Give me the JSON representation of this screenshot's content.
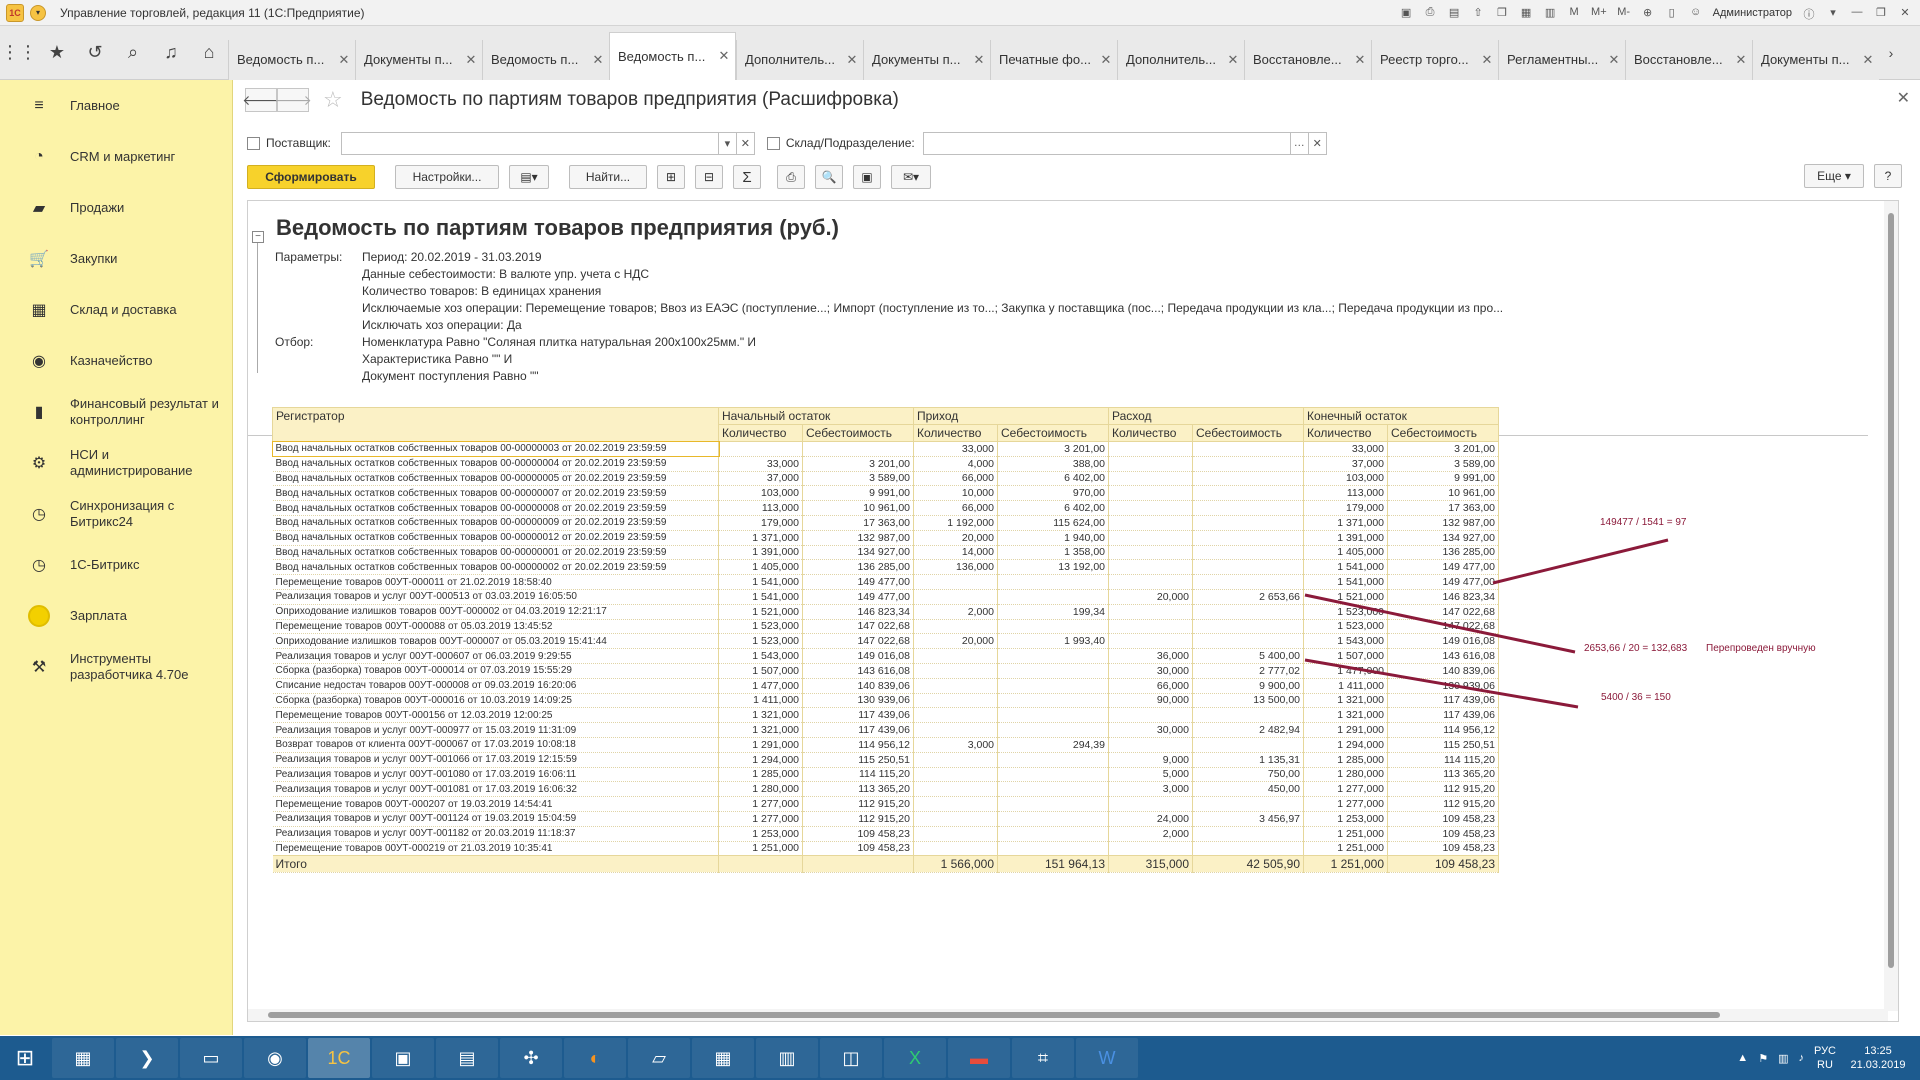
{
  "window": {
    "title": "Управление торговлей, редакция 11  (1С:Предприятие)",
    "user": "Администратор",
    "logo_text": "1С",
    "tools": [
      "M",
      "M+",
      "M-"
    ]
  },
  "tabs": [
    {
      "label": "Ведомость п..."
    },
    {
      "label": "Документы п..."
    },
    {
      "label": "Ведомость п..."
    },
    {
      "label": "Ведомость п...",
      "active": true
    },
    {
      "label": "Дополнитель..."
    },
    {
      "label": "Документы п..."
    },
    {
      "label": "Печатные фо..."
    },
    {
      "label": "Дополнитель..."
    },
    {
      "label": "Восстановле..."
    },
    {
      "label": "Реестр торго..."
    },
    {
      "label": "Регламентны..."
    },
    {
      "label": "Восстановле..."
    },
    {
      "label": "Документы п..."
    }
  ],
  "sidebar": {
    "items": [
      {
        "label": "Главное",
        "icon": "menu-icon"
      },
      {
        "label": "CRM и маркетинг",
        "icon": "crm-icon"
      },
      {
        "label": "Продажи",
        "icon": "sales-bag-icon"
      },
      {
        "label": "Закупки",
        "icon": "cart-icon"
      },
      {
        "label": "Склад и доставка",
        "icon": "warehouse-icon"
      },
      {
        "label": "Казначейство",
        "icon": "treasury-icon"
      },
      {
        "label": "Финансовый результат и контроллинг",
        "icon": "chart-icon"
      },
      {
        "label": "НСИ и администрирование",
        "icon": "gear-icon"
      },
      {
        "label": "Синхронизация с Битрикс24",
        "icon": "sync-icon"
      },
      {
        "label": "1С-Битрикс",
        "icon": "bitrix-icon"
      },
      {
        "label": "Зарплата",
        "icon": "salary-coin-icon"
      },
      {
        "label": "Инструменты разработчика 4.70e",
        "icon": "dev-tools-icon"
      }
    ]
  },
  "form": {
    "title": "Ведомость по партиям товаров предприятия (Расшифровка)",
    "filter_supplier_label": "Поставщик:",
    "filter_supplier_value": "",
    "filter_warehouse_label": "Склад/Подразделение:",
    "filter_warehouse_value": "",
    "btn_generate": "Сформировать",
    "btn_settings": "Настройки...",
    "btn_find": "Найти...",
    "btn_more": "Еще",
    "btn_help": "?"
  },
  "report": {
    "title": "Ведомость по партиям товаров предприятия (руб.)",
    "params_label": "Параметры:",
    "filter_label": "Отбор:",
    "params": [
      "Период: 20.02.2019 - 31.03.2019",
      "Данные себестоимости: В валюте упр. учета с НДС",
      "Количество товаров: В единицах хранения",
      "Исключаемые хоз операции: Перемещение товаров; Ввоз из ЕАЭС (поступление...; Импорт (поступление из то...; Закупка у поставщика (пос...; Передача продукции из кла...; Передача продукции из про...",
      "Исключать хоз операции: Да"
    ],
    "filters": [
      "Номенклатура Равно \"Соляная плитка натуральная 200х100х25мм.\" И",
      "Характеристика Равно \"\" И",
      "Документ поступления Равно \"\""
    ],
    "columns": {
      "registrar": "Регистратор",
      "group_start": "Начальный остаток",
      "group_in": "Приход",
      "group_out": "Расход",
      "group_end": "Конечный остаток",
      "qty": "Количество",
      "cost": "Себестоимость"
    },
    "rows": [
      [
        "Ввод начальных остатков собственных товаров 00-00000003 от 20.02.2019 23:59:59",
        "",
        "",
        "33,000",
        "3 201,00",
        "",
        "",
        "33,000",
        "3 201,00"
      ],
      [
        "Ввод начальных остатков собственных товаров 00-00000004 от 20.02.2019 23:59:59",
        "33,000",
        "3 201,00",
        "4,000",
        "388,00",
        "",
        "",
        "37,000",
        "3 589,00"
      ],
      [
        "Ввод начальных остатков собственных товаров 00-00000005 от 20.02.2019 23:59:59",
        "37,000",
        "3 589,00",
        "66,000",
        "6 402,00",
        "",
        "",
        "103,000",
        "9 991,00"
      ],
      [
        "Ввод начальных остатков собственных товаров 00-00000007 от 20.02.2019 23:59:59",
        "103,000",
        "9 991,00",
        "10,000",
        "970,00",
        "",
        "",
        "113,000",
        "10 961,00"
      ],
      [
        "Ввод начальных остатков собственных товаров 00-00000008 от 20.02.2019 23:59:59",
        "113,000",
        "10 961,00",
        "66,000",
        "6 402,00",
        "",
        "",
        "179,000",
        "17 363,00"
      ],
      [
        "Ввод начальных остатков собственных товаров 00-00000009 от 20.02.2019 23:59:59",
        "179,000",
        "17 363,00",
        "1 192,000",
        "115 624,00",
        "",
        "",
        "1 371,000",
        "132 987,00"
      ],
      [
        "Ввод начальных остатков собственных товаров 00-00000012 от 20.02.2019 23:59:59",
        "1 371,000",
        "132 987,00",
        "20,000",
        "1 940,00",
        "",
        "",
        "1 391,000",
        "134 927,00"
      ],
      [
        "Ввод начальных остатков собственных товаров 00-00000001 от 20.02.2019 23:59:59",
        "1 391,000",
        "134 927,00",
        "14,000",
        "1 358,00",
        "",
        "",
        "1 405,000",
        "136 285,00"
      ],
      [
        "Ввод начальных остатков собственных товаров 00-00000002 от 20.02.2019 23:59:59",
        "1 405,000",
        "136 285,00",
        "136,000",
        "13 192,00",
        "",
        "",
        "1 541,000",
        "149 477,00"
      ],
      [
        "Перемещение товаров 00УТ-000011 от 21.02.2019 18:58:40",
        "1 541,000",
        "149 477,00",
        "",
        "",
        "",
        "",
        "1 541,000",
        "149 477,00"
      ],
      [
        "Реализация товаров и услуг 00УТ-000513 от 03.03.2019 16:05:50",
        "1 541,000",
        "149 477,00",
        "",
        "",
        "20,000",
        "2 653,66",
        "1 521,000",
        "146 823,34"
      ],
      [
        "Оприходование излишков товаров 00УТ-000002 от 04.03.2019 12:21:17",
        "1 521,000",
        "146 823,34",
        "2,000",
        "199,34",
        "",
        "",
        "1 523,000",
        "147 022,68"
      ],
      [
        "Перемещение товаров 00УТ-000088 от 05.03.2019 13:45:52",
        "1 523,000",
        "147 022,68",
        "",
        "",
        "",
        "",
        "1 523,000",
        "147 022,68"
      ],
      [
        "Оприходование излишков товаров 00УТ-000007 от 05.03.2019 15:41:44",
        "1 523,000",
        "147 022,68",
        "20,000",
        "1 993,40",
        "",
        "",
        "1 543,000",
        "149 016,08"
      ],
      [
        "Реализация товаров и услуг 00УТ-000607 от 06.03.2019 9:29:55",
        "1 543,000",
        "149 016,08",
        "",
        "",
        "36,000",
        "5 400,00",
        "1 507,000",
        "143 616,08"
      ],
      [
        "Сборка (разборка) товаров 00УТ-000014 от 07.03.2019 15:55:29",
        "1 507,000",
        "143 616,08",
        "",
        "",
        "30,000",
        "2 777,02",
        "1 477,000",
        "140 839,06"
      ],
      [
        "Списание недостач товаров 00УТ-000008 от 09.03.2019 16:20:06",
        "1 477,000",
        "140 839,06",
        "",
        "",
        "66,000",
        "9 900,00",
        "1 411,000",
        "130 939,06"
      ],
      [
        "Сборка (разборка) товаров 00УТ-000016 от 10.03.2019 14:09:25",
        "1 411,000",
        "130 939,06",
        "",
        "",
        "90,000",
        "13 500,00",
        "1 321,000",
        "117 439,06"
      ],
      [
        "Перемещение товаров 00УТ-000156 от 12.03.2019 12:00:25",
        "1 321,000",
        "117 439,06",
        "",
        "",
        "",
        "",
        "1 321,000",
        "117 439,06"
      ],
      [
        "Реализация товаров и услуг 00УТ-000977 от 15.03.2019 11:31:09",
        "1 321,000",
        "117 439,06",
        "",
        "",
        "30,000",
        "2 482,94",
        "1 291,000",
        "114 956,12"
      ],
      [
        "Возврат товаров от клиента 00УТ-000067 от 17.03.2019 10:08:18",
        "1 291,000",
        "114 956,12",
        "3,000",
        "294,39",
        "",
        "",
        "1 294,000",
        "115 250,51"
      ],
      [
        "Реализация товаров и услуг 00УТ-001066 от 17.03.2019 12:15:59",
        "1 294,000",
        "115 250,51",
        "",
        "",
        "9,000",
        "1 135,31",
        "1 285,000",
        "114 115,20"
      ],
      [
        "Реализация товаров и услуг 00УТ-001080 от 17.03.2019 16:06:11",
        "1 285,000",
        "114 115,20",
        "",
        "",
        "5,000",
        "750,00",
        "1 280,000",
        "113 365,20"
      ],
      [
        "Реализация товаров и услуг 00УТ-001081 от 17.03.2019 16:06:32",
        "1 280,000",
        "113 365,20",
        "",
        "",
        "3,000",
        "450,00",
        "1 277,000",
        "112 915,20"
      ],
      [
        "Перемещение товаров 00УТ-000207 от 19.03.2019 14:54:41",
        "1 277,000",
        "112 915,20",
        "",
        "",
        "",
        "",
        "1 277,000",
        "112 915,20"
      ],
      [
        "Реализация товаров и услуг 00УТ-001124 от 19.03.2019 15:04:59",
        "1 277,000",
        "112 915,20",
        "",
        "",
        "24,000",
        "3 456,97",
        "1 253,000",
        "109 458,23"
      ],
      [
        "Реализация товаров и услуг 00УТ-001182 от 20.03.2019 11:18:37",
        "1 253,000",
        "109 458,23",
        "",
        "",
        "2,000",
        "",
        "1 251,000",
        "109 458,23"
      ],
      [
        "Перемещение товаров 00УТ-000219 от 21.03.2019 10:35:41",
        "1 251,000",
        "109 458,23",
        "",
        "",
        "",
        "",
        "1 251,000",
        "109 458,23"
      ]
    ],
    "total": [
      "Итого",
      "",
      "",
      "1 566,000",
      "151 964,13",
      "315,000",
      "42 505,90",
      "1 251,000",
      "109 458,23"
    ]
  },
  "annotations": {
    "note1": "149477 / 1541 = 97",
    "note2": "2653,66 / 20 = 132,683",
    "note2b": "Перепроведен вручную",
    "note3": "5400 / 36 = 150",
    "color": "#8b1a3a"
  },
  "tray": {
    "lang_top": "РУС",
    "lang_bottom": "RU",
    "time": "13:25",
    "date": "21.03.2019"
  }
}
